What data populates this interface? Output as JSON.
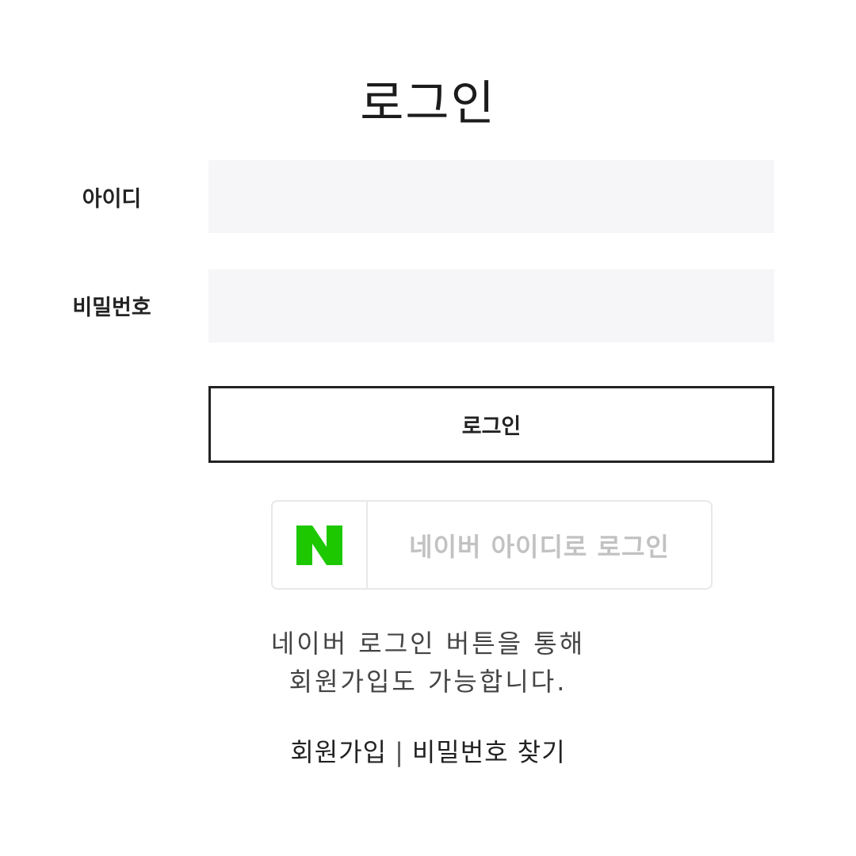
{
  "page": {
    "title": "로그인"
  },
  "form": {
    "id_label": "아이디",
    "id_value": "",
    "password_label": "비밀번호",
    "password_value": "",
    "login_button_label": "로그인"
  },
  "naver": {
    "logo_letter": "N",
    "logo_color": "#1ec800",
    "button_label": "네이버 아이디로 로그인"
  },
  "note": {
    "line1": "네이버 로그인 버튼을 통해",
    "line2": "회원가입도 가능합니다."
  },
  "links": {
    "signup": "회원가입",
    "separator": "|",
    "find_password": "비밀번호 찾기"
  }
}
